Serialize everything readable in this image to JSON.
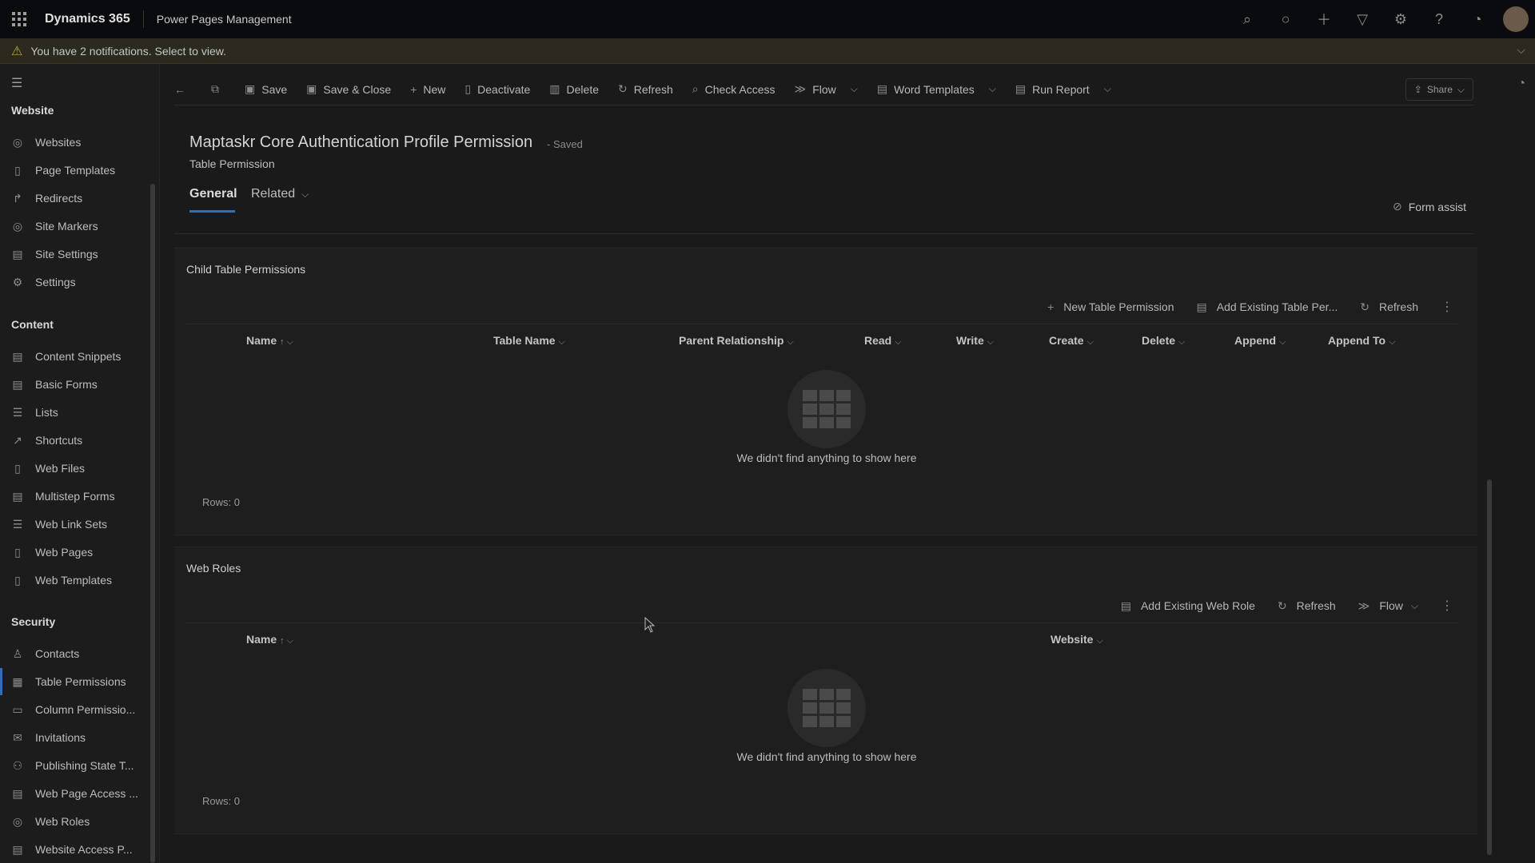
{
  "topbar": {
    "brand": "Dynamics 365",
    "app_name": "Power Pages Management",
    "icons": [
      "search-icon",
      "lightbulb-icon",
      "plus-icon",
      "filter-icon",
      "gear-icon",
      "help-icon",
      "copilot-icon",
      "avatar"
    ]
  },
  "notification": {
    "message": "You have 2 notifications. Select to view."
  },
  "sidebar": {
    "groups": [
      {
        "title": "Website",
        "items": [
          {
            "label": "Websites",
            "icon": "globe-icon"
          },
          {
            "label": "Page Templates",
            "icon": "page-icon"
          },
          {
            "label": "Redirects",
            "icon": "redirect-icon"
          },
          {
            "label": "Site Markers",
            "icon": "globe-icon"
          },
          {
            "label": "Site Settings",
            "icon": "settings-list-icon"
          },
          {
            "label": "Settings",
            "icon": "gear-icon"
          }
        ]
      },
      {
        "title": "Content",
        "items": [
          {
            "label": "Content Snippets",
            "icon": "snippet-icon"
          },
          {
            "label": "Basic Forms",
            "icon": "form-icon"
          },
          {
            "label": "Lists",
            "icon": "list-icon"
          },
          {
            "label": "Shortcuts",
            "icon": "shortcut-icon"
          },
          {
            "label": "Web Files",
            "icon": "file-icon"
          },
          {
            "label": "Multistep Forms",
            "icon": "form-icon"
          },
          {
            "label": "Web Link Sets",
            "icon": "list-icon"
          },
          {
            "label": "Web Pages",
            "icon": "page-icon"
          },
          {
            "label": "Web Templates",
            "icon": "page-icon"
          }
        ]
      },
      {
        "title": "Security",
        "items": [
          {
            "label": "Contacts",
            "icon": "person-icon"
          },
          {
            "label": "Table Permissions",
            "icon": "table-permission-icon",
            "active": true
          },
          {
            "label": "Column Permissio...",
            "icon": "column-icon"
          },
          {
            "label": "Invitations",
            "icon": "invitation-icon"
          },
          {
            "label": "Publishing State T...",
            "icon": "publish-icon"
          },
          {
            "label": "Web Page Access ...",
            "icon": "page-access-icon"
          },
          {
            "label": "Web Roles",
            "icon": "globe-icon"
          },
          {
            "label": "Website Access P...",
            "icon": "page-access-icon"
          }
        ]
      }
    ]
  },
  "commandbar": {
    "items": [
      {
        "label": "",
        "icon": "back-arrow-icon"
      },
      {
        "label": "",
        "icon": "popout-icon"
      },
      {
        "label": "Save",
        "icon": "save-icon"
      },
      {
        "label": "Save & Close",
        "icon": "save-close-icon"
      },
      {
        "label": "New",
        "icon": "plus-icon"
      },
      {
        "label": "Deactivate",
        "icon": "deactivate-icon"
      },
      {
        "label": "Delete",
        "icon": "trash-icon"
      },
      {
        "label": "Refresh",
        "icon": "refresh-icon"
      },
      {
        "label": "Check Access",
        "icon": "check-access-icon"
      },
      {
        "label": "Flow",
        "icon": "flow-icon",
        "dropdown": true
      },
      {
        "label": "Word Templates",
        "icon": "word-icon",
        "dropdown": true
      },
      {
        "label": "Run Report",
        "icon": "report-icon",
        "dropdown": true
      }
    ],
    "share_label": "Share"
  },
  "header": {
    "title": "Maptaskr Core Authentication Profile Permission",
    "saved_status": "- Saved",
    "entity": "Table Permission",
    "tabs": [
      {
        "label": "General",
        "active": true
      },
      {
        "label": "Related",
        "dropdown": true
      }
    ],
    "form_assist": "Form assist"
  },
  "child_permissions": {
    "title": "Child Table Permissions",
    "commands": [
      {
        "label": "New Table Permission",
        "icon": "plus-icon"
      },
      {
        "label": "Add Existing Table Per...",
        "icon": "add-existing-icon"
      },
      {
        "label": "Refresh",
        "icon": "refresh-icon"
      }
    ],
    "columns": [
      "Name",
      "Table Name",
      "Parent Relationship",
      "Read",
      "Write",
      "Create",
      "Delete",
      "Append",
      "Append To"
    ],
    "empty_text": "We didn't find anything to show here",
    "rows_text": "Rows: 0"
  },
  "web_roles": {
    "title": "Web Roles",
    "commands": [
      {
        "label": "Add Existing Web Role",
        "icon": "add-existing-icon"
      },
      {
        "label": "Refresh",
        "icon": "refresh-icon"
      },
      {
        "label": "Flow",
        "icon": "flow-icon",
        "dropdown": true
      }
    ],
    "columns": [
      "Name",
      "Website"
    ],
    "empty_text": "We didn't find anything to show here",
    "rows_text": "Rows: 0"
  },
  "colors": {
    "accent": "#2f6fb7",
    "topbar": "#0a0b0e",
    "notification_bg": "#2c2a1f",
    "warning": "#b8a14a"
  }
}
